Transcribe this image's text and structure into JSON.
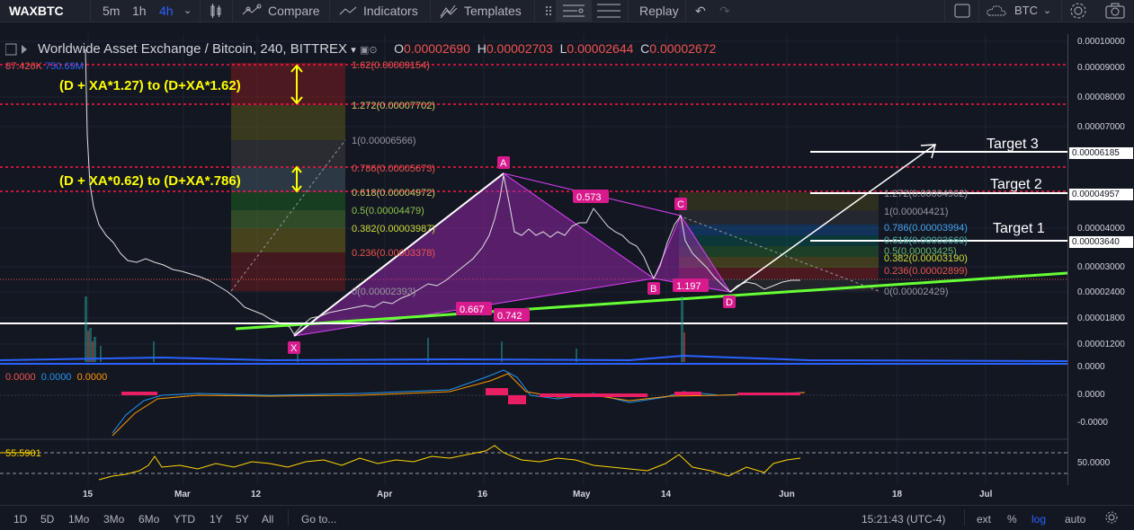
{
  "toolbar": {
    "symbol": "WAXBTC",
    "intervals": [
      "5m",
      "1h",
      "4h"
    ],
    "active_interval": "4h",
    "compare": "Compare",
    "indicators": "Indicators",
    "templates": "Templates",
    "replay": "Replay",
    "currency": "BTC"
  },
  "legend": {
    "title": "Worldwide Asset Exchange / Bitcoin, 240, BITTREX",
    "o_label": "O",
    "o_value": "0.00002690",
    "h_label": "H",
    "h_value": "0.00002703",
    "l_label": "L",
    "l_value": "0.00002644",
    "c_label": "C",
    "c_value": "0.00002672",
    "volume_red": "87.426K",
    "volume_blue": "750.69M"
  },
  "price_axis": [
    "0.00010000",
    "0.00009000",
    "0.00008000",
    "0.00007000",
    "0.00005000",
    "0.00004000",
    "0.00003000",
    "0.00002400",
    "0.00001800",
    "0.00001200"
  ],
  "price_tags": {
    "target3": "0.00006185",
    "target2": "0.00004957",
    "target1": "0.00003640"
  },
  "time_axis": [
    "15",
    "Mar",
    "12",
    "Apr",
    "16",
    "May",
    "14",
    "Jun",
    "18",
    "Jul"
  ],
  "fib_left": [
    {
      "label": "1.62(0.00009154)",
      "color": "#ef5350"
    },
    {
      "label": "1.272(0.00007702)",
      "color": "#d4c86a"
    },
    {
      "label": "1(0.00006566)",
      "color": "#9598a1"
    },
    {
      "label": "0.786(0.00005673)",
      "color": "#ef5350"
    },
    {
      "label": "0.618(0.00004972)",
      "color": "#d4c86a"
    },
    {
      "label": "0.5(0.00004479)",
      "color": "#8bc34a"
    },
    {
      "label": "0.382(0.00003987)",
      "color": "#cddc39"
    },
    {
      "label": "0.236(0.00003378)",
      "color": "#ef5350"
    },
    {
      "label": "0(0.00002393)",
      "color": "#9598a1"
    }
  ],
  "fib_right": [
    {
      "label": "1.272(0.00004962)",
      "color": "#9598a1"
    },
    {
      "label": "1(0.00004421)",
      "color": "#9598a1"
    },
    {
      "label": "0.786(0.00003994)",
      "color": "#42a5f5"
    },
    {
      "label": "0.618(0.00003660)",
      "color": "#4db6ac"
    },
    {
      "label": "0.5(0.00003425)",
      "color": "#66bb6a"
    },
    {
      "label": "0.382(0.00003190)",
      "color": "#cddc39"
    },
    {
      "label": "0.236(0.00002899)",
      "color": "#ef5350"
    },
    {
      "label": "0(0.00002429)",
      "color": "#9598a1"
    }
  ],
  "annotations": {
    "upper_range": "(D + XA*1.27) to (D+XA*1.62)",
    "lower_range": "(D + XA*0.62) to (D+XA*.786)",
    "target1": "Target 1",
    "target2": "Target 2",
    "target3": "Target 3"
  },
  "pattern": {
    "points": [
      "X",
      "A",
      "B",
      "C",
      "D"
    ],
    "ratios": {
      "xab": "0.667",
      "xb": "0.742",
      "ac": "0.573",
      "bd": "1.197"
    }
  },
  "macd": {
    "v1": "0.0000",
    "v2": "0.0000",
    "v3": "0.0000",
    "axis": [
      "0.0000",
      "0.0000",
      "-0.0000"
    ]
  },
  "rsi": {
    "value": "55.5901",
    "axis": "50.0000"
  },
  "bottom": {
    "ranges": [
      "1D",
      "5D",
      "1Mo",
      "3Mo",
      "6Mo",
      "YTD",
      "1Y",
      "5Y",
      "All"
    ],
    "goto": "Go to...",
    "time": "15:21:43 (UTC-4)",
    "ext": "ext",
    "pct": "%",
    "log": "log",
    "auto": "auto"
  },
  "colors": {
    "bg": "#131722",
    "green_line": "#66ff33",
    "pattern_fill": "#9c27b0",
    "accent": "#2962ff"
  }
}
